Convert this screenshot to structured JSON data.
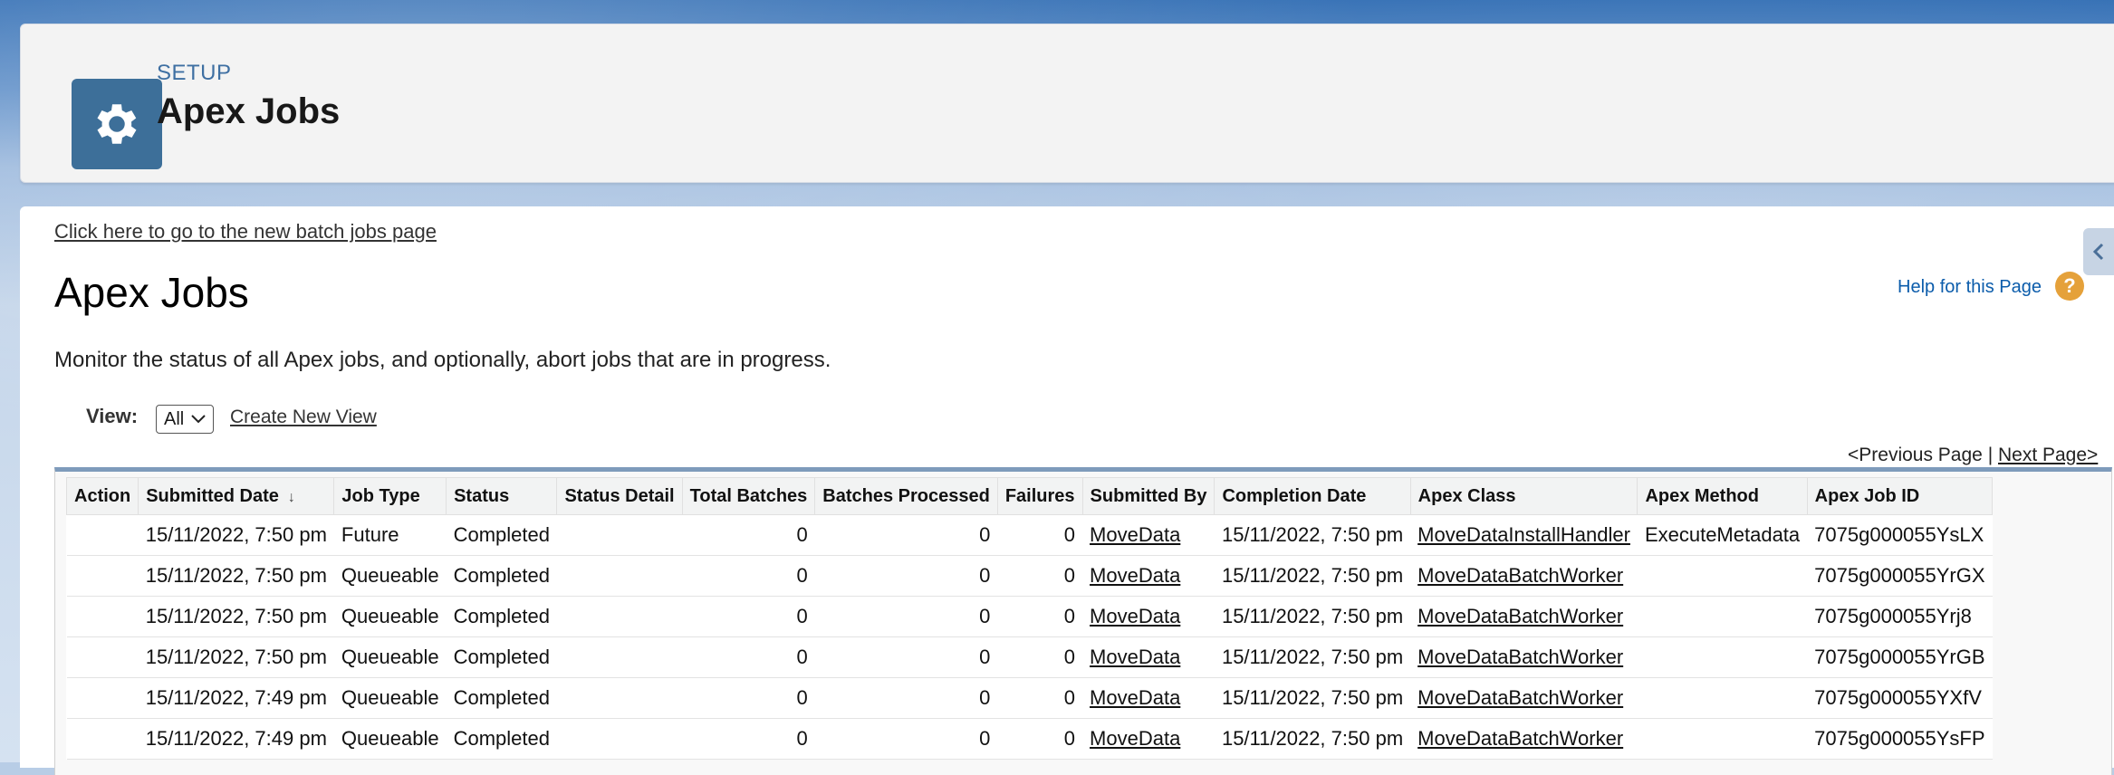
{
  "header": {
    "setup_label": "SETUP",
    "title": "Apex Jobs",
    "icon": "gear-icon"
  },
  "content": {
    "new_batch_link": "Click here to go to the new batch jobs page",
    "title": "Apex Jobs",
    "help_link": "Help for this Page",
    "help_icon_glyph": "?",
    "description": "Monitor the status of all Apex jobs, and optionally, abort jobs that are in progress.",
    "view_label": "View:",
    "view_selected": "All",
    "create_view": "Create New View",
    "pager_prev": "<Previous Page",
    "pager_sep": " | ",
    "pager_next": "Next Page>"
  },
  "table": {
    "columns": [
      "Action",
      "Submitted Date",
      "Job Type",
      "Status",
      "Status Detail",
      "Total Batches",
      "Batches Processed",
      "Failures",
      "Submitted By",
      "Completion Date",
      "Apex Class",
      "Apex Method",
      "Apex Job ID"
    ],
    "sorted_column": "Submitted Date",
    "sort_direction": "descending",
    "rows": [
      {
        "action": "",
        "submitted_date": "15/11/2022, 7:50 pm",
        "job_type": "Future",
        "status": "Completed",
        "status_detail": "",
        "total_batches": "0",
        "batches_processed": "0",
        "failures": "0",
        "submitted_by": "MoveData",
        "completion_date": "15/11/2022, 7:50 pm",
        "apex_class": "MoveDataInstallHandler",
        "apex_method": "ExecuteMetadata",
        "job_id": "7075g000055YsLX"
      },
      {
        "action": "",
        "submitted_date": "15/11/2022, 7:50 pm",
        "job_type": "Queueable",
        "status": "Completed",
        "status_detail": "",
        "total_batches": "0",
        "batches_processed": "0",
        "failures": "0",
        "submitted_by": "MoveData",
        "completion_date": "15/11/2022, 7:50 pm",
        "apex_class": "MoveDataBatchWorker",
        "apex_method": "",
        "job_id": "7075g000055YrGX"
      },
      {
        "action": "",
        "submitted_date": "15/11/2022, 7:50 pm",
        "job_type": "Queueable",
        "status": "Completed",
        "status_detail": "",
        "total_batches": "0",
        "batches_processed": "0",
        "failures": "0",
        "submitted_by": "MoveData",
        "completion_date": "15/11/2022, 7:50 pm",
        "apex_class": "MoveDataBatchWorker",
        "apex_method": "",
        "job_id": "7075g000055Yrj8"
      },
      {
        "action": "",
        "submitted_date": "15/11/2022, 7:50 pm",
        "job_type": "Queueable",
        "status": "Completed",
        "status_detail": "",
        "total_batches": "0",
        "batches_processed": "0",
        "failures": "0",
        "submitted_by": "MoveData",
        "completion_date": "15/11/2022, 7:50 pm",
        "apex_class": "MoveDataBatchWorker",
        "apex_method": "",
        "job_id": "7075g000055YrGB"
      },
      {
        "action": "",
        "submitted_date": "15/11/2022, 7:49 pm",
        "job_type": "Queueable",
        "status": "Completed",
        "status_detail": "",
        "total_batches": "0",
        "batches_processed": "0",
        "failures": "0",
        "submitted_by": "MoveData",
        "completion_date": "15/11/2022, 7:50 pm",
        "apex_class": "MoveDataBatchWorker",
        "apex_method": "",
        "job_id": "7075g000055YXfV"
      },
      {
        "action": "",
        "submitted_date": "15/11/2022, 7:49 pm",
        "job_type": "Queueable",
        "status": "Completed",
        "status_detail": "",
        "total_batches": "0",
        "batches_processed": "0",
        "failures": "0",
        "submitted_by": "MoveData",
        "completion_date": "15/11/2022, 7:50 pm",
        "apex_class": "MoveDataBatchWorker",
        "apex_method": "",
        "job_id": "7075g000055YsFP"
      }
    ]
  },
  "colors": {
    "brand_blue": "#3d6f99",
    "link_blue": "#0b5cab",
    "help_orange": "#e5a13a",
    "table_top_border": "#7e9bbb"
  }
}
